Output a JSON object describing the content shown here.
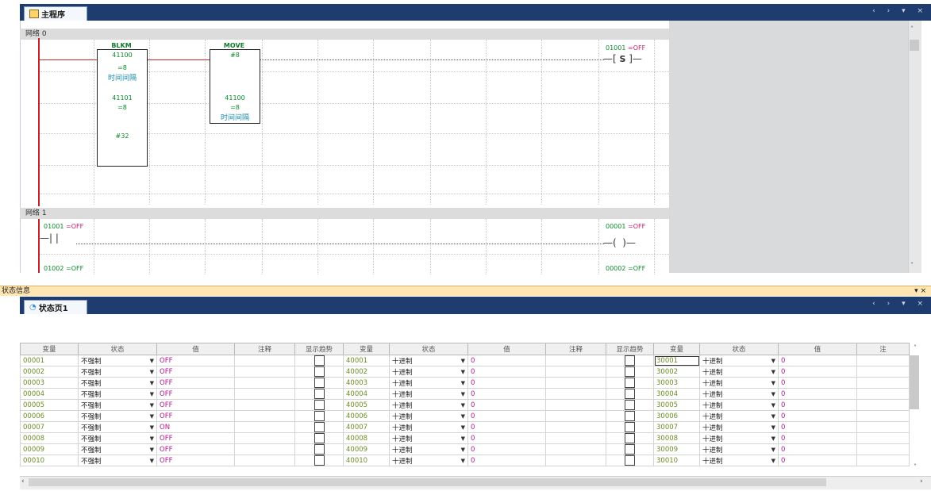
{
  "main_tab": {
    "title": "主程序"
  },
  "window_controls": "‹ › ▾ ×",
  "networks": [
    {
      "label": "网络 0"
    },
    {
      "label": "网络 1"
    }
  ],
  "blocks": {
    "blkm": {
      "title": "BLKM",
      "in1": "41100",
      "in1_val": "=8",
      "in1_note": "时间间隔",
      "in2": "41101",
      "in2_val": "=8",
      "in3": "#32"
    },
    "move": {
      "title": "MOVE",
      "in1": "#8",
      "out": "41100",
      "out_val": "=8",
      "out_note": "时间间隔"
    }
  },
  "coils": {
    "set_coil": {
      "addr": "01001",
      "state": "=OFF",
      "symbol": "S"
    },
    "out_coil": {
      "addr": "00001",
      "state": "=OFF"
    },
    "contact": {
      "addr": "01001",
      "state": "=OFF"
    },
    "partial_left": "01002 =OFF",
    "partial_right": "00002 =OFF"
  },
  "status_panel": {
    "title": "状态信息",
    "tab": "状态页1",
    "controls": "▾ ×"
  },
  "table": {
    "headers": [
      "变量",
      "状态",
      "值",
      "注释",
      "显示趋势",
      "变量",
      "状态",
      "值",
      "注释",
      "显示趋势",
      "变量",
      "状态",
      "值",
      "注"
    ],
    "rows": [
      [
        "00001",
        "不强制",
        "OFF",
        "40001",
        "十进制",
        "0",
        "30001",
        "十进制",
        "0"
      ],
      [
        "00002",
        "不强制",
        "OFF",
        "40002",
        "十进制",
        "0",
        "30002",
        "十进制",
        "0"
      ],
      [
        "00003",
        "不强制",
        "OFF",
        "40003",
        "十进制",
        "0",
        "30003",
        "十进制",
        "0"
      ],
      [
        "00004",
        "不强制",
        "OFF",
        "40004",
        "十进制",
        "0",
        "30004",
        "十进制",
        "0"
      ],
      [
        "00005",
        "不强制",
        "OFF",
        "40005",
        "十进制",
        "0",
        "30005",
        "十进制",
        "0"
      ],
      [
        "00006",
        "不强制",
        "OFF",
        "40006",
        "十进制",
        "0",
        "30006",
        "十进制",
        "0"
      ],
      [
        "00007",
        "不强制",
        "ON",
        "40007",
        "十进制",
        "0",
        "30007",
        "十进制",
        "0"
      ],
      [
        "00008",
        "不强制",
        "OFF",
        "40008",
        "十进制",
        "0",
        "30008",
        "十进制",
        "0"
      ],
      [
        "00009",
        "不强制",
        "OFF",
        "40009",
        "十进制",
        "0",
        "30009",
        "十进制",
        "0"
      ],
      [
        "00010",
        "不强制",
        "OFF",
        "40010",
        "十进制",
        "0",
        "30010",
        "十进制",
        "0"
      ]
    ]
  },
  "colors": {
    "tabbar": "#1f3c6e",
    "rail": "#c0242a",
    "var": "#6b8e23",
    "value": "#b2198f"
  }
}
